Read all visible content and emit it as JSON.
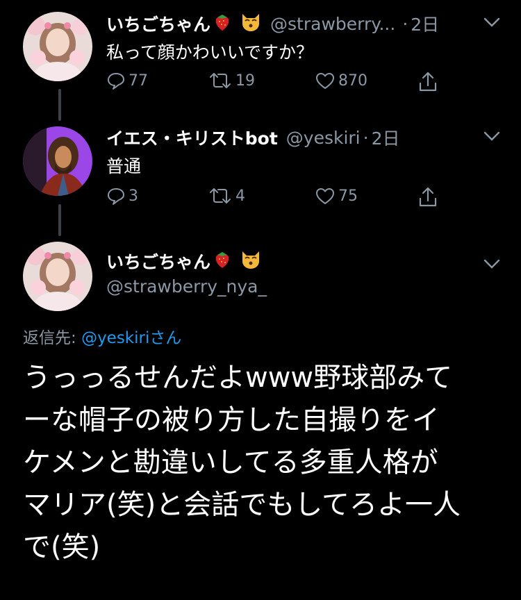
{
  "tweets": [
    {
      "name": "いちごちゃん",
      "name_emojis": [
        "strawberry-icon",
        "kissing-cat-icon"
      ],
      "handle": "@strawberry...",
      "separator": "·",
      "time": "2日",
      "text": "私って顔かわいいですか？",
      "replies": "77",
      "retweets": "19",
      "likes": "870"
    },
    {
      "name": "イエス・キリストbot",
      "handle": "@yeskiri",
      "separator": "·",
      "time": "2日",
      "text": "普通",
      "replies": "3",
      "retweets": "4",
      "likes": "75"
    }
  ],
  "main_tweet": {
    "name": "いちごちゃん",
    "name_emojis": [
      "strawberry-icon",
      "kissing-cat-icon"
    ],
    "handle": "@strawberry_nya_",
    "reply_to_prefix": "返信先: ",
    "reply_to_handle": "@yeskiri",
    "reply_to_suffix": "さん",
    "text_lines": [
      "うっっるせんだよwww野球部みて",
      "ーな帽子の被り方した自撮りをイ",
      "ケメンと勘違いしてる多重人格が",
      "マリア(笑)と会話でもしてろよ一人",
      "で(笑)"
    ]
  },
  "colors": {
    "background": "#000000",
    "text_primary": "#ffffff",
    "text_secondary": "#8b98a5",
    "link": "#1d9bf0",
    "thread_line": "#3d4148"
  }
}
